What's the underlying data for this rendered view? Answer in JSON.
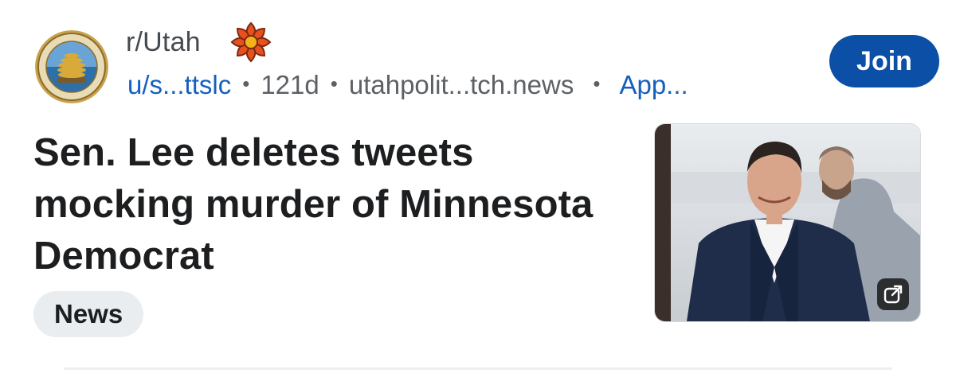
{
  "subreddit": {
    "name": "r/Utah",
    "avatar_icon": "utah-seal-beehive-icon",
    "flair_icon": "sego-lily-flower-icon"
  },
  "meta": {
    "user": "u/s...ttslc",
    "age": "121d",
    "domain": "utahpolit...tch.news",
    "app": "App...",
    "separator": "•"
  },
  "join_label": "Join",
  "post": {
    "title": "Sen. Lee deletes tweets mocking murder of Minnesota Democrat",
    "flair": "News"
  },
  "thumbnail": {
    "external_link_icon": "external-link-icon"
  },
  "colors": {
    "accent": "#0b4fa6",
    "link": "#1560bd",
    "chip_bg": "#eaedef",
    "text": "#1c1e20"
  }
}
